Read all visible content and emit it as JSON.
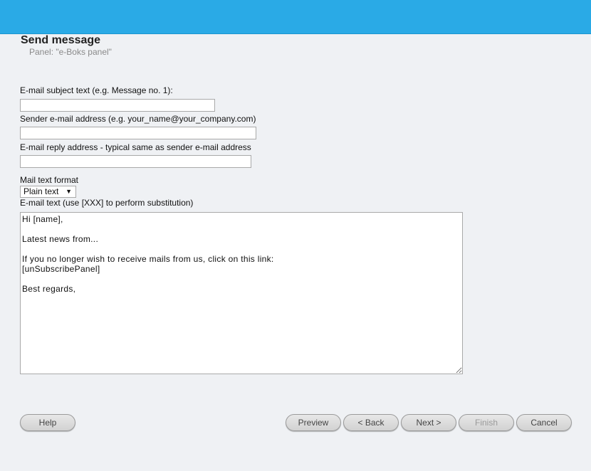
{
  "header": {
    "title": "Send message",
    "subtitle": "Panel: \"e-Boks panel\""
  },
  "form": {
    "subject_label": "E-mail subject text (e.g. Message no. 1):",
    "subject_value": "",
    "sender_label": "Sender e-mail address (e.g. your_name@your_company.com)",
    "sender_value": "",
    "reply_label": "E-mail reply address - typical same as sender e-mail address",
    "reply_value": "",
    "format_label": "Mail text format",
    "format_selected": "Plain text",
    "text_label": "E-mail text (use [XXX] to perform substitution)",
    "text_value": "Hi [name],\n\nLatest news from...\n\nIf you no longer wish to receive mails from us, click on this link:\n[unSubscribePanel]\n\nBest regards,"
  },
  "buttons": {
    "help": "Help",
    "preview": "Preview",
    "back": "< Back",
    "next": "Next >",
    "finish": "Finish",
    "cancel": "Cancel"
  },
  "colors": {
    "topbar": "#2aaae6",
    "background": "#eff1f4"
  }
}
